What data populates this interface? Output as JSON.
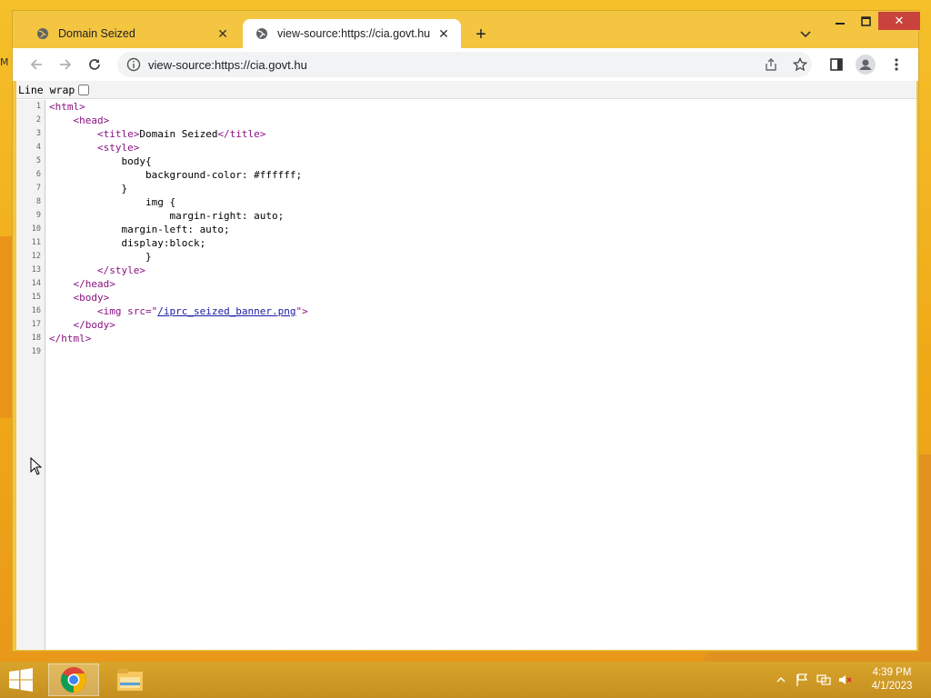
{
  "tabs": [
    {
      "label": "Domain Seized",
      "active": false
    },
    {
      "label": "view-source:https://cia.govt.hu",
      "active": true
    }
  ],
  "address": {
    "url": "view-source:https://cia.govt.hu"
  },
  "viewer": {
    "line_wrap_label": "Line wrap",
    "line_wrap_checked": false
  },
  "code_lines": [
    {
      "n": "1",
      "html": "<span class='tag'>&lt;html&gt;</span>"
    },
    {
      "n": "2",
      "html": "    <span class='tag'>&lt;head&gt;</span>"
    },
    {
      "n": "3",
      "html": "        <span class='tag'>&lt;title&gt;</span>Domain Seized<span class='tag'>&lt;/title&gt;</span>"
    },
    {
      "n": "4",
      "html": "        <span class='tag'>&lt;style&gt;</span>"
    },
    {
      "n": "5",
      "html": "            body{"
    },
    {
      "n": "6",
      "html": "                background-color: #ffffff;"
    },
    {
      "n": "7",
      "html": "            }"
    },
    {
      "n": "8",
      "html": "                img {"
    },
    {
      "n": "9",
      "html": "                    margin-right: auto;"
    },
    {
      "n": "10",
      "html": "            margin-left: auto;"
    },
    {
      "n": "11",
      "html": "            display:block;"
    },
    {
      "n": "12",
      "html": "                }"
    },
    {
      "n": "13",
      "html": "        <span class='tag'>&lt;/style&gt;</span>"
    },
    {
      "n": "14",
      "html": "    <span class='tag'>&lt;/head&gt;</span>"
    },
    {
      "n": "15",
      "html": "    <span class='tag'>&lt;body&gt;</span>"
    },
    {
      "n": "16",
      "html": "        <span class='tag'>&lt;img src=\"</span><span class='link'>/iprc_seized_banner.png</span><span class='tag'>\"&gt;</span>"
    },
    {
      "n": "17",
      "html": "    <span class='tag'>&lt;/body&gt;</span>"
    },
    {
      "n": "18",
      "html": "<span class='tag'>&lt;/html&gt;</span>"
    },
    {
      "n": "19",
      "html": ""
    }
  ],
  "clock": {
    "time": "4:39 PM",
    "date": "4/1/2023"
  }
}
